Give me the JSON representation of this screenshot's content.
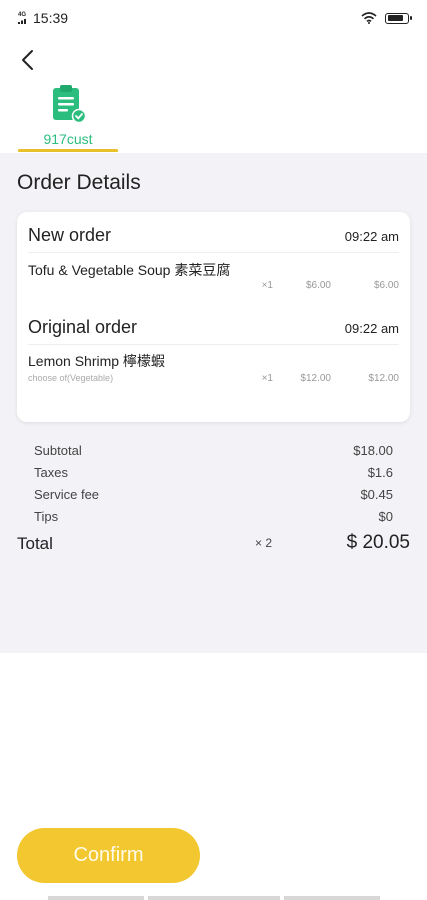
{
  "status_bar": {
    "network": "4G",
    "time": "15:39",
    "icons": [
      "signal-icon",
      "wifi-icon",
      "battery-icon"
    ]
  },
  "nav": {
    "back_icon": "chevron-left-icon"
  },
  "tab": {
    "icon": "clipboard-check-icon",
    "label": "917cust",
    "icon_color": "#2bbd7e",
    "underline_color": "#e8c12a"
  },
  "page": {
    "title": "Order Details"
  },
  "new_order": {
    "title": "New order",
    "time": "09:22 am",
    "items": [
      {
        "name": "Tofu & Vegetable Soup 素菜豆腐",
        "qty": "×1",
        "unit_price": "$6.00",
        "total": "$6.00"
      }
    ]
  },
  "original_order": {
    "title": "Original order",
    "time": "09:22 am",
    "items": [
      {
        "name": "Lemon Shrimp 檸檬蝦",
        "note": "choose of(Vegetable)",
        "qty": "×1",
        "unit_price": "$12.00",
        "total": "$12.00"
      }
    ]
  },
  "summary": {
    "subtotal_label": "Subtotal",
    "subtotal_value": "$18.00",
    "taxes_label": "Taxes",
    "taxes_value": "$1.6",
    "service_fee_label": "Service fee",
    "service_fee_value": "$0.45",
    "tips_label": "Tips",
    "tips_value": "$0",
    "total_label": "Total",
    "total_count": "× 2",
    "total_value": "$ 20.05"
  },
  "actions": {
    "confirm_label": "Confirm",
    "confirm_color": "#f2c72f"
  }
}
